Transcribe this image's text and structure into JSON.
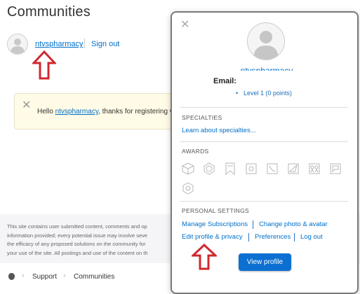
{
  "page": {
    "title": "Communities"
  },
  "header": {
    "username": "ntvspharmacy",
    "signout": "Sign out"
  },
  "welcome": {
    "hello": "Hello",
    "username": "ntvspharmacy",
    "message": ", thanks for registering wi"
  },
  "footer": {
    "lines": [
      "This site contains user submitted content, comments and op",
      "information provided; every potential issue may involve seve",
      "the efficacy of any proposed solutions on the community for",
      "your use of the site. All postings and use of the content on th"
    ]
  },
  "breadcrumb": {
    "items": [
      "Support",
      "Communities"
    ]
  },
  "popup": {
    "username": "ntvspharmacy",
    "email_label": "Email:",
    "level": "Level 1 (0 points)",
    "specialties": {
      "title": "SPECIALTIES",
      "link": "Learn about specialties..."
    },
    "awards": {
      "title": "AWARDS",
      "icons": [
        "cube-award-icon",
        "sphere-award-icon",
        "bookmark-award-icon",
        "puzzle-award-icon",
        "phone-award-icon",
        "paper-plane-award-icon",
        "team-award-icon",
        "chat-award-icon",
        "gear-award-icon"
      ]
    },
    "personal_settings": {
      "title": "PERSONAL SETTINGS",
      "manage_subscriptions": "Manage Subscriptions",
      "change_photo": "Change photo & avatar",
      "edit_profile": "Edit profile & privacy",
      "preferences": "Preferences",
      "logout": "Log out"
    },
    "view_profile": "View profile"
  },
  "colors": {
    "link": "#0070c9",
    "annotation_arrow": "#d0282e",
    "button": "#0b70d2"
  }
}
